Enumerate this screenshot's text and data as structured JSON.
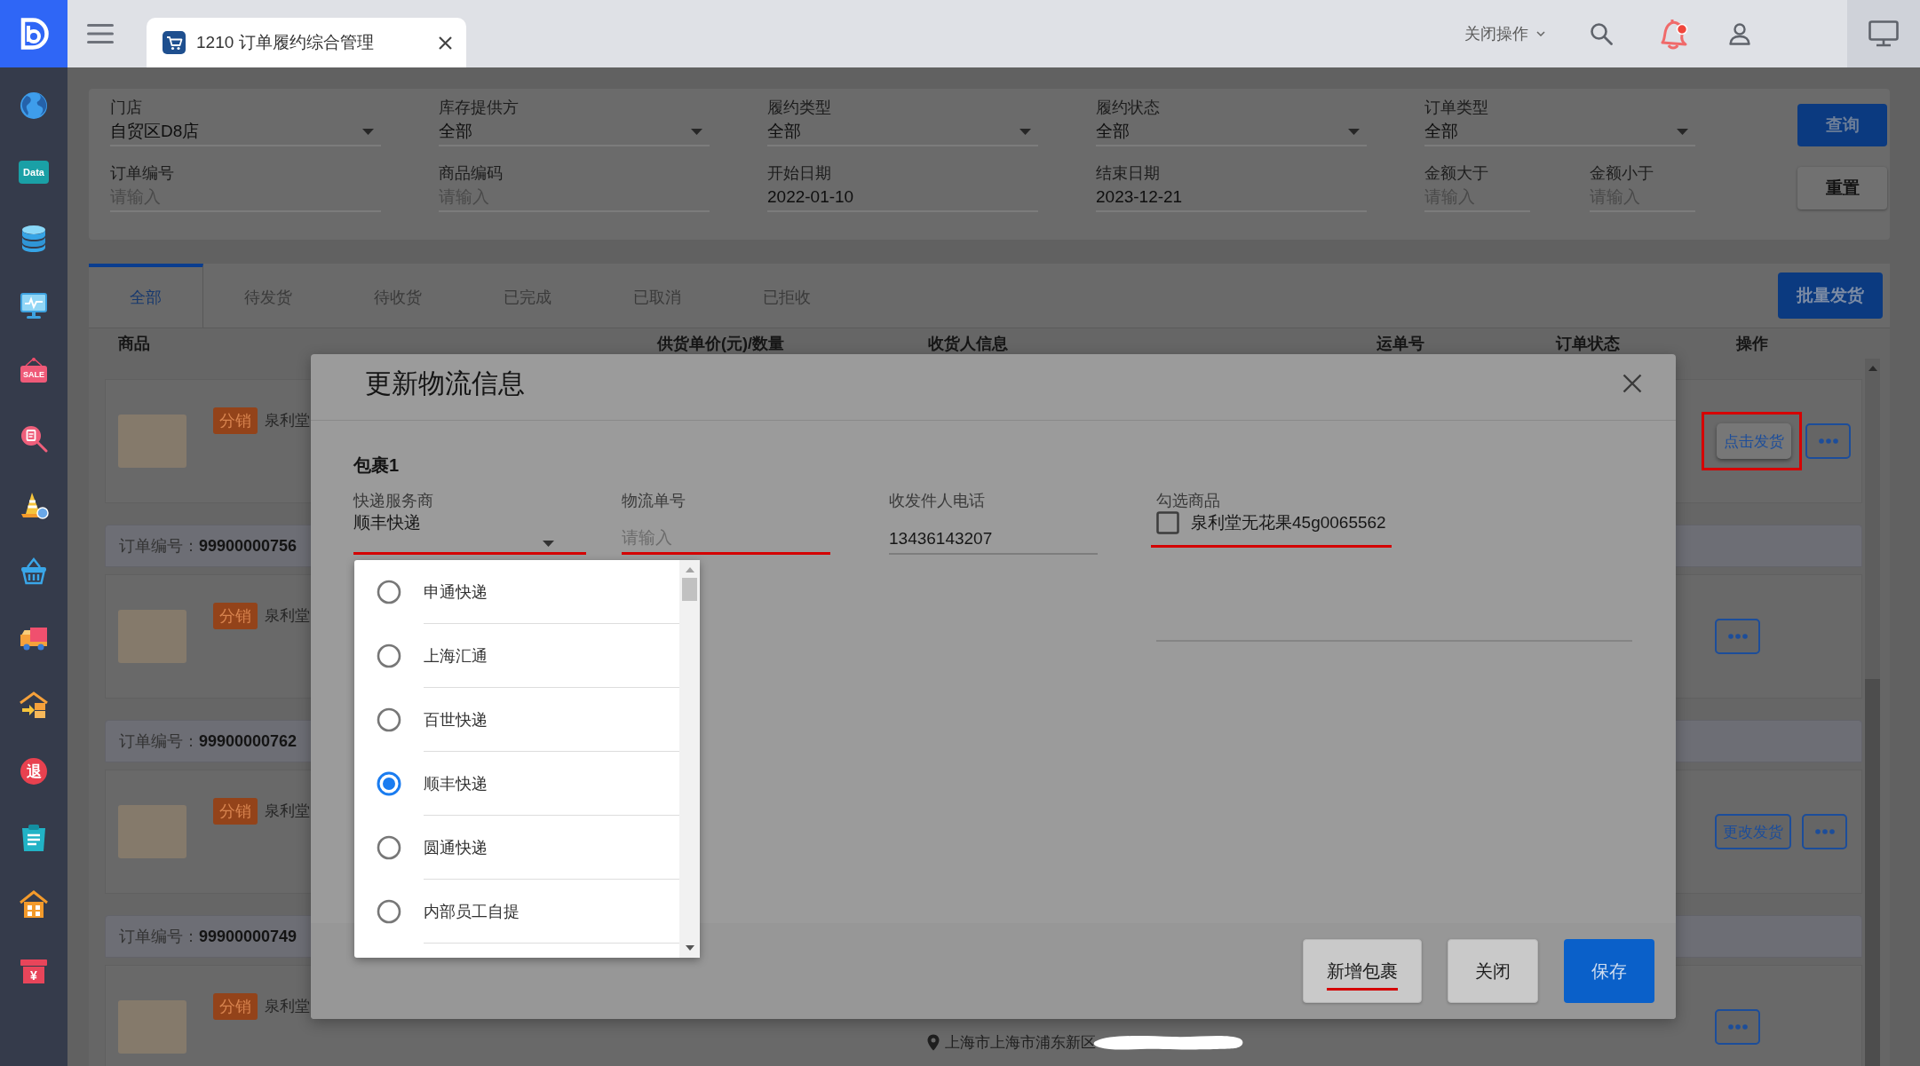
{
  "topbar": {
    "tabs": [
      {
        "title": "1210 订单履约综合管理",
        "selected": true
      }
    ],
    "actions_menu": "关闭操作",
    "notifications": {
      "unread": true
    }
  },
  "sidebar": {
    "items": [
      {
        "kind": "globe"
      },
      {
        "kind": "data",
        "text": "Data"
      },
      {
        "kind": "database"
      },
      {
        "kind": "monitor"
      },
      {
        "kind": "sale",
        "text": "SALE"
      },
      {
        "kind": "search"
      },
      {
        "kind": "cone"
      },
      {
        "kind": "basket"
      },
      {
        "kind": "truck"
      },
      {
        "kind": "warehouse"
      },
      {
        "kind": "refund",
        "text": "退"
      },
      {
        "kind": "notes"
      },
      {
        "kind": "house"
      },
      {
        "kind": "cashbox",
        "text": "¥"
      }
    ]
  },
  "filters": {
    "fields": [
      {
        "kind": "select",
        "label": "门店",
        "value": "自贸区D8店"
      },
      {
        "kind": "select",
        "label": "库存提供方",
        "value": "全部"
      },
      {
        "kind": "select",
        "label": "履约类型",
        "value": "全部"
      },
      {
        "kind": "select",
        "label": "履约状态",
        "value": "全部"
      },
      {
        "kind": "select",
        "label": "订单类型",
        "value": "全部"
      },
      {
        "kind": "input",
        "label": "订单编号",
        "placeholder": "请输入"
      },
      {
        "kind": "input",
        "label": "商品编码",
        "placeholder": "请输入"
      },
      {
        "kind": "input",
        "label": "开始日期",
        "value": "2022-01-10"
      },
      {
        "kind": "input",
        "label": "结束日期",
        "value": "2023-12-21"
      },
      {
        "kind": "pair",
        "fields": [
          {
            "kind": "input",
            "label": "金额大于",
            "placeholder": "请输入"
          },
          {
            "kind": "input",
            "label": "金额小于",
            "placeholder": "请输入"
          }
        ]
      }
    ],
    "buttons": [
      {
        "kind": "primary",
        "label": "查询"
      },
      {
        "kind": "default",
        "label": "重置"
      }
    ]
  },
  "status_tabs": [
    {
      "label": "全部",
      "selected": true
    },
    {
      "label": "待发货",
      "selected": false
    },
    {
      "label": "待收货",
      "selected": false
    },
    {
      "label": "已完成",
      "selected": false
    },
    {
      "label": "已取消",
      "selected": false
    },
    {
      "label": "已拒收",
      "selected": false
    }
  ],
  "batch_button": "批量发货",
  "table": {
    "columns": [
      "商品",
      "供货单价(元)/数量",
      "收货人信息",
      "运单号",
      "订单状态",
      "操作"
    ],
    "orders": [
      {
        "badge": "分销",
        "product": "泉利堂",
        "actions": [
          {
            "kind": "plain",
            "label": "点击发货",
            "annotated": true
          },
          {
            "kind": "more",
            "annotated": false
          }
        ]
      },
      {
        "order_label": "订单编号：",
        "order_no": "99900000756",
        "badge": "分销",
        "product": "泉利堂",
        "actions": [
          {
            "kind": "more",
            "annotated": false
          }
        ]
      },
      {
        "order_label": "订单编号：",
        "order_no": "99900000762",
        "badge": "分销",
        "product": "泉利堂",
        "actions": [
          {
            "kind": "outline",
            "label": "更改发货",
            "annotated": false
          },
          {
            "kind": "more",
            "annotated": false
          }
        ]
      },
      {
        "order_label": "订单编号：",
        "order_no": "99900000749",
        "badge": "分销",
        "product": "泉利堂",
        "receiver": {
          "address": "上海市上海市浦东新区",
          "redacted": true
        },
        "actions": [
          {
            "kind": "more",
            "annotated": false
          }
        ]
      }
    ]
  },
  "dialog": {
    "title": "更新物流信息",
    "packages": [
      {
        "title": "包裹1",
        "fields": [
          {
            "kind": "select",
            "label": "快递服务商",
            "value": "顺丰快递",
            "annotated": true,
            "expanded": true,
            "options": [
              {
                "label": "申通快递",
                "selected": false
              },
              {
                "label": "上海汇通",
                "selected": false
              },
              {
                "label": "百世快递",
                "selected": false
              },
              {
                "label": "顺丰快递",
                "selected": true
              },
              {
                "label": "圆通快递",
                "selected": false
              },
              {
                "label": "内部员工自提",
                "selected": false
              }
            ]
          },
          {
            "kind": "input",
            "label": "物流单号",
            "placeholder": "请输入",
            "annotated": true
          },
          {
            "kind": "input",
            "label": "收发件人电话",
            "value": "13436143207",
            "annotated": false
          },
          {
            "kind": "checklist",
            "label": "勾选商品",
            "options": [
              {
                "label": "泉利堂无花果45g0065562",
                "checked": false,
                "annotated": true
              }
            ]
          }
        ]
      }
    ],
    "buttons": [
      {
        "kind": "default",
        "label": "新增包裹",
        "annotated": true
      },
      {
        "kind": "default",
        "label": "关闭",
        "annotated": false
      },
      {
        "kind": "primary",
        "label": "保存",
        "annotated": false
      }
    ]
  }
}
